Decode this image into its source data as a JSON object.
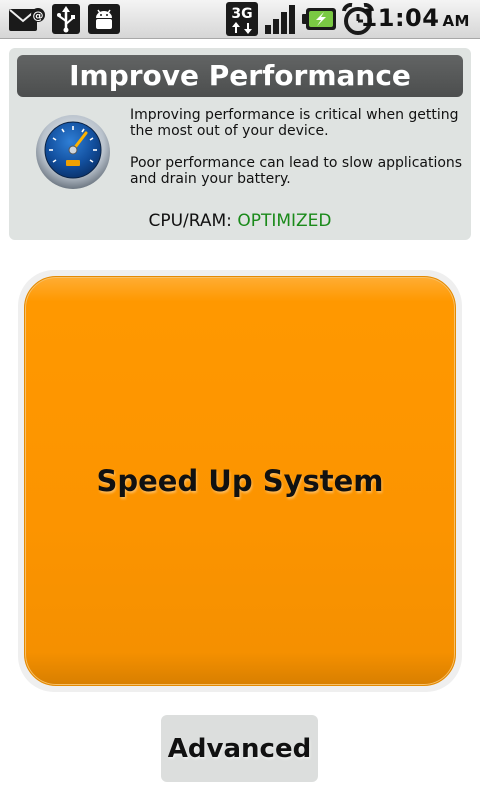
{
  "status_bar": {
    "time": "11:04",
    "ampm": "AM",
    "network": "3G",
    "icons": [
      "mail-icon",
      "usb-icon",
      "android-debug-icon",
      "3g-icon",
      "signal-icon",
      "battery-charging-icon",
      "alarm-clock-icon"
    ]
  },
  "panel": {
    "title": "Improve Performance",
    "paragraph1": "Improving performance is critical when getting the most out of your device.",
    "paragraph2": "Poor performance can lead to slow applications and drain your battery.",
    "cpu_label": "CPU/RAM:",
    "cpu_status": "OPTIMIZED",
    "gauge_icon": "speedometer-icon"
  },
  "speed_button": {
    "label": "Speed Up System"
  },
  "advanced_button": {
    "label": "Advanced"
  },
  "colors": {
    "accent": "#ff9800",
    "optimized": "#1a8a1a",
    "title_bar": "#555757",
    "panel_bg": "#dfe3e1"
  }
}
